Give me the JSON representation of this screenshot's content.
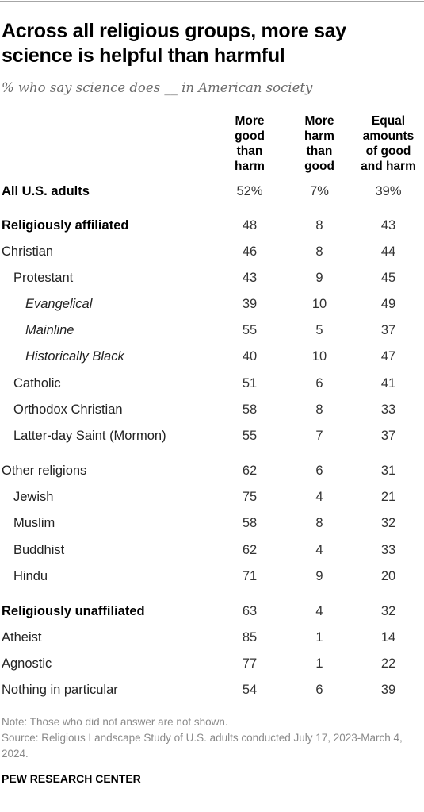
{
  "chart_data": {
    "type": "table",
    "title": "Across all religious groups, more say science is helpful than harmful",
    "subtitle": "% who say science does __ in American society",
    "columns": [
      {
        "lines": [
          "More",
          "good",
          "than",
          "harm"
        ],
        "name": "More good than harm"
      },
      {
        "lines": [
          "More",
          "harm",
          "than",
          "good"
        ],
        "name": "More harm than good"
      },
      {
        "lines": [
          "Equal",
          "amounts",
          "of good",
          "and harm"
        ],
        "name": "Equal amounts of good and harm"
      }
    ],
    "rows": [
      {
        "label": "All U.S. adults",
        "style": "bold",
        "values": [
          "52%",
          "7%",
          "39%"
        ]
      },
      {
        "label": "Religiously affiliated",
        "style": "bold",
        "values": [
          "48",
          "8",
          "43"
        ]
      },
      {
        "label": "Christian",
        "style": "normal",
        "values": [
          "46",
          "8",
          "44"
        ]
      },
      {
        "label": "Protestant",
        "style": "indent1",
        "values": [
          "43",
          "9",
          "45"
        ]
      },
      {
        "label": "Evangelical",
        "style": "indent2",
        "values": [
          "39",
          "10",
          "49"
        ]
      },
      {
        "label": "Mainline",
        "style": "indent2",
        "values": [
          "55",
          "5",
          "37"
        ]
      },
      {
        "label": "Historically Black",
        "style": "indent2",
        "values": [
          "40",
          "10",
          "47"
        ]
      },
      {
        "label": "Catholic",
        "style": "indent1",
        "values": [
          "51",
          "6",
          "41"
        ]
      },
      {
        "label": "Orthodox Christian",
        "style": "indent1",
        "values": [
          "58",
          "8",
          "33"
        ]
      },
      {
        "label": "Latter-day Saint (Mormon)",
        "style": "indent1",
        "values": [
          "55",
          "7",
          "37"
        ]
      },
      {
        "label": "Other religions",
        "style": "normal",
        "values": [
          "62",
          "6",
          "31"
        ]
      },
      {
        "label": "Jewish",
        "style": "indent1",
        "values": [
          "75",
          "4",
          "21"
        ]
      },
      {
        "label": "Muslim",
        "style": "indent1",
        "values": [
          "58",
          "8",
          "32"
        ]
      },
      {
        "label": "Buddhist",
        "style": "indent1",
        "values": [
          "62",
          "4",
          "33"
        ]
      },
      {
        "label": "Hindu",
        "style": "indent1",
        "values": [
          "71",
          "9",
          "20"
        ]
      },
      {
        "label": "Religiously unaffiliated",
        "style": "bold",
        "values": [
          "63",
          "4",
          "32"
        ]
      },
      {
        "label": "Atheist",
        "style": "normal",
        "values": [
          "85",
          "1",
          "14"
        ]
      },
      {
        "label": "Agnostic",
        "style": "normal",
        "values": [
          "77",
          "1",
          "22"
        ]
      },
      {
        "label": "Nothing in particular",
        "style": "normal",
        "values": [
          "54",
          "6",
          "39"
        ]
      }
    ]
  },
  "footer": {
    "note": "Note: Those who did not answer are not shown.",
    "source": "Source: Religious Landscape Study of U.S. adults conducted July 17, 2023-March 4, 2024.",
    "brand": "PEW RESEARCH CENTER"
  }
}
